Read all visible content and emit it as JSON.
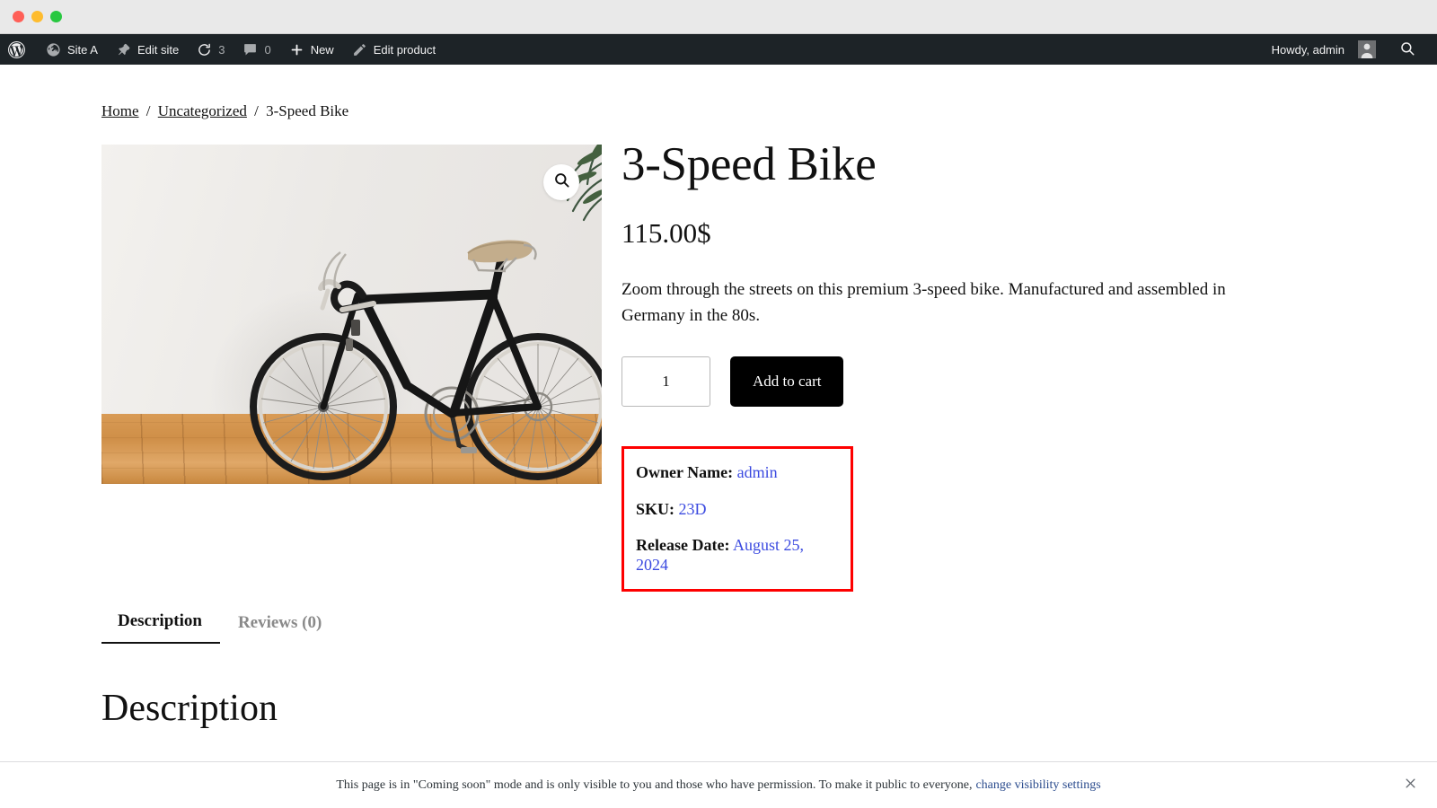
{
  "window": {
    "traffic_lights": [
      "close",
      "minimize",
      "maximize"
    ]
  },
  "adminbar": {
    "logo_icon": "wordpress-icon",
    "items": [
      {
        "icon": "dashboard-icon",
        "label": "Site A"
      },
      {
        "icon": "pushpin-icon",
        "label": "Edit site"
      },
      {
        "icon": "updates-icon",
        "label": "3"
      },
      {
        "icon": "comment-icon",
        "label": "0"
      },
      {
        "icon": "plus-icon",
        "label": "New"
      },
      {
        "icon": "pencil-icon",
        "label": "Edit product"
      }
    ],
    "howdy": "Howdy, admin",
    "avatar_icon": "avatar-icon",
    "search_icon": "search-icon"
  },
  "breadcrumb": {
    "home": "Home",
    "category": "Uncategorized",
    "current": "3-Speed Bike",
    "separator": "/"
  },
  "gallery": {
    "zoom_icon": "magnifier-icon",
    "image_alt": "3-Speed Bike leaning against a white wall on a wooden floor"
  },
  "product": {
    "title": "3-Speed Bike",
    "price": "115.00$",
    "short_description": "Zoom through the streets on this premium 3-speed bike. Manufactured and assembled in Germany in the 80s.",
    "quantity_value": "1",
    "quantity_placeholder": "1",
    "add_to_cart_label": "Add to cart"
  },
  "meta_box": {
    "border_color": "#fe0000",
    "value_color": "#3b4ae0",
    "rows": [
      {
        "label": "Owner Name:",
        "value": "admin"
      },
      {
        "label": "SKU:",
        "value": "23D"
      },
      {
        "label": "Release Date:",
        "value": "August 25, 2024"
      }
    ]
  },
  "tabs": [
    {
      "label": "Description",
      "active": true
    },
    {
      "label": "Reviews (0)",
      "active": false
    }
  ],
  "description_section": {
    "heading": "Description"
  },
  "notice": {
    "text": "This page is in \"Coming soon\" mode and is only visible to you and those who have permission. To make it public to everyone,",
    "link": "change visibility settings",
    "close_icon": "close-icon"
  }
}
